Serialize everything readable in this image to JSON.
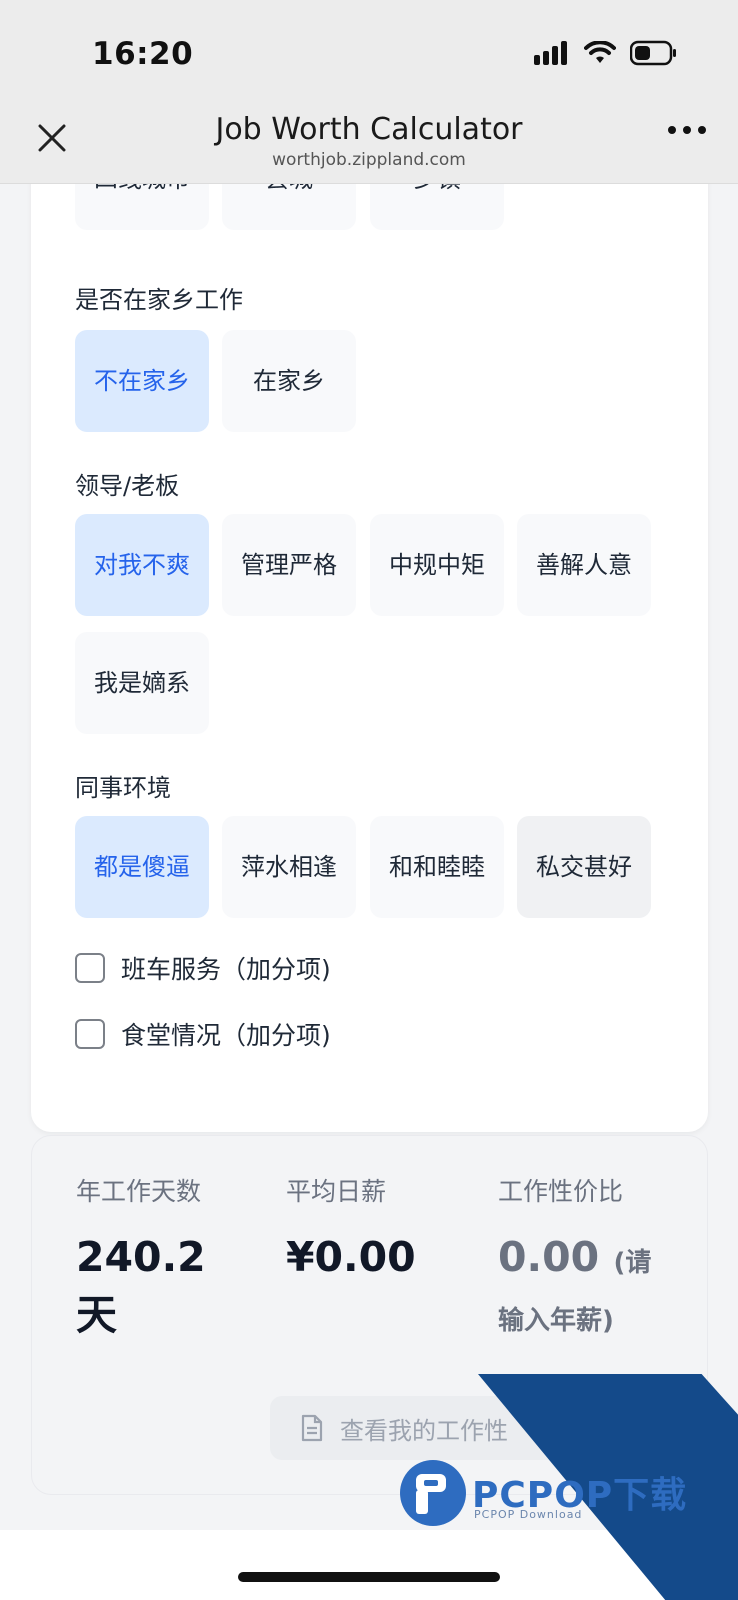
{
  "status_bar": {
    "time": "16:20"
  },
  "header": {
    "title": "Job Worth Calculator",
    "url": "worthjob.zippland.com"
  },
  "city_options": {
    "items": [
      "四线城市",
      "县城",
      "乡镇"
    ]
  },
  "hometown": {
    "label": "是否在家乡工作",
    "options": [
      {
        "label": "不在家乡",
        "selected": true
      },
      {
        "label": "在家乡",
        "selected": false
      }
    ]
  },
  "boss": {
    "label": "领导/老板",
    "options": [
      {
        "label": "对我不爽",
        "selected": true
      },
      {
        "label": "管理严格",
        "selected": false
      },
      {
        "label": "中规中矩",
        "selected": false
      },
      {
        "label": "善解人意",
        "selected": false
      },
      {
        "label": "我是嫡系",
        "selected": false
      }
    ]
  },
  "colleagues": {
    "label": "同事环境",
    "options": [
      {
        "label": "都是傻逼",
        "selected": true
      },
      {
        "label": "萍水相逢",
        "selected": false
      },
      {
        "label": "和和睦睦",
        "selected": false
      },
      {
        "label": "私交甚好",
        "selected": false
      }
    ]
  },
  "checkboxes": [
    {
      "label": "班车服务（加分项)",
      "checked": false
    },
    {
      "label": "食堂情况（加分项)",
      "checked": false
    }
  ],
  "results": {
    "work_days": {
      "label": "年工作天数",
      "value": "240.2",
      "unit": "天"
    },
    "daily_salary": {
      "label": "平均日薪",
      "value": "¥0.00"
    },
    "value_ratio": {
      "label": "工作性价比",
      "value": "0.00",
      "note_1": "(请",
      "note_2": "输入年薪)"
    },
    "report_button": "查看我的工作性"
  },
  "watermark": {
    "brand": "PCPOP下载",
    "sub": "PCPOP Download"
  },
  "colors": {
    "accent": "#2563eb",
    "selected_bg": "#dbeafe",
    "watermark_blue": "#144a8a"
  }
}
